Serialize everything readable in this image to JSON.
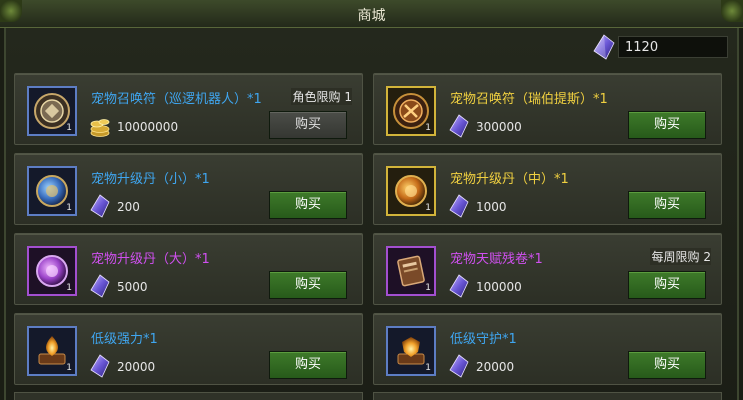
{
  "window": {
    "title": "商城"
  },
  "currency": {
    "icon": "crystal-icon",
    "amount": "1120"
  },
  "colors": {
    "name_blue": "#3fa6f0",
    "name_gold": "#f0d040",
    "name_purple": "#d050f0",
    "buy_green": "#3e7a2a",
    "buy_disabled": "#4b4d48"
  },
  "items": [
    {
      "name": "宠物召唤符（巡逻机器人）*1",
      "rarity": "blue",
      "icon": "summon-talisman-robot-icon",
      "qty": "1",
      "limit": "角色限购 1",
      "price_icon": "gold-coins-icon",
      "price": "10000000",
      "button": "购买",
      "button_enabled": false
    },
    {
      "name": "宠物召唤符（瑞伯提斯）*1",
      "rarity": "gold",
      "icon": "summon-talisman-ribertis-icon",
      "qty": "1",
      "limit": "",
      "price_icon": "crystal-icon",
      "price": "300000",
      "button": "购买",
      "button_enabled": true
    },
    {
      "name": "宠物升级丹（小）*1",
      "rarity": "blue",
      "icon": "pet-upgrade-pill-small-icon",
      "qty": "1",
      "limit": "",
      "price_icon": "crystal-icon",
      "price": "200",
      "button": "购买",
      "button_enabled": true
    },
    {
      "name": "宠物升级丹（中）*1",
      "rarity": "gold",
      "icon": "pet-upgrade-pill-medium-icon",
      "qty": "1",
      "limit": "",
      "price_icon": "crystal-icon",
      "price": "1000",
      "button": "购买",
      "button_enabled": true
    },
    {
      "name": "宠物升级丹（大）*1",
      "rarity": "purple",
      "icon": "pet-upgrade-pill-large-icon",
      "qty": "1",
      "limit": "",
      "price_icon": "crystal-icon",
      "price": "5000",
      "button": "购买",
      "button_enabled": true
    },
    {
      "name": "宠物天赋残卷*1",
      "rarity": "purple",
      "icon": "pet-talent-scroll-icon",
      "qty": "1",
      "limit": "每周限购 2",
      "price_icon": "crystal-icon",
      "price": "100000",
      "button": "购买",
      "button_enabled": true
    },
    {
      "name": "低级强力*1",
      "rarity": "blue",
      "icon": "low-power-book-icon",
      "qty": "1",
      "limit": "",
      "price_icon": "crystal-icon",
      "price": "20000",
      "button": "购买",
      "button_enabled": true
    },
    {
      "name": "低级守护*1",
      "rarity": "blue",
      "icon": "low-guard-book-icon",
      "qty": "1",
      "limit": "",
      "price_icon": "crystal-icon",
      "price": "20000",
      "button": "购买",
      "button_enabled": true
    }
  ]
}
